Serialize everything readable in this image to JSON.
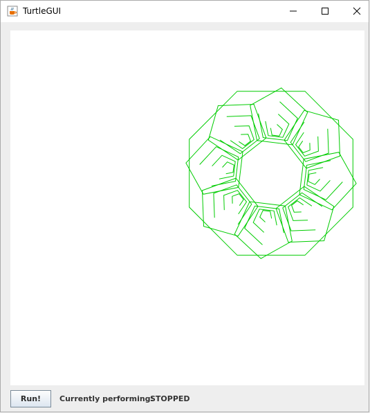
{
  "window": {
    "title": "TurtleGUI",
    "app_icon": "java-coffee-cup-icon",
    "controls": {
      "minimize_icon": "minimize-icon",
      "maximize_icon": "maximize-icon",
      "close_icon": "close-icon"
    }
  },
  "canvas": {
    "background": "#ffffff",
    "stroke_color": "#00cc00",
    "drawing_description_icon": "turtle-drawing"
  },
  "bottom_bar": {
    "run_label": "Run!",
    "status_label": "Currently performing:",
    "status_value": "STOPPED"
  }
}
